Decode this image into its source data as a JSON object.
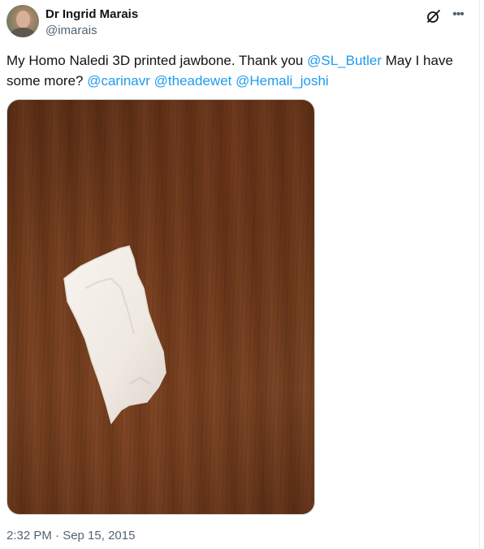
{
  "author": {
    "display_name": "Dr Ingrid Marais",
    "handle": "@imarais"
  },
  "tweet": {
    "text_1": "My Homo Naledi 3D printed jawbone. Thank you ",
    "mention_1": "@SL_Butler",
    "text_2": " May I have some more? ",
    "mention_2": "@carinavr",
    "text_3": " ",
    "mention_3": "@theadewet",
    "text_4": " ",
    "mention_4": "@Hemali_joshi"
  },
  "timestamp": "2:32 PM · Sep 15, 2015",
  "icons": {
    "grok": "grok-icon",
    "more": "more-icon"
  },
  "colors": {
    "mention": "#1d9bf0",
    "secondary_text": "#536471",
    "primary_text": "#0f1419"
  }
}
